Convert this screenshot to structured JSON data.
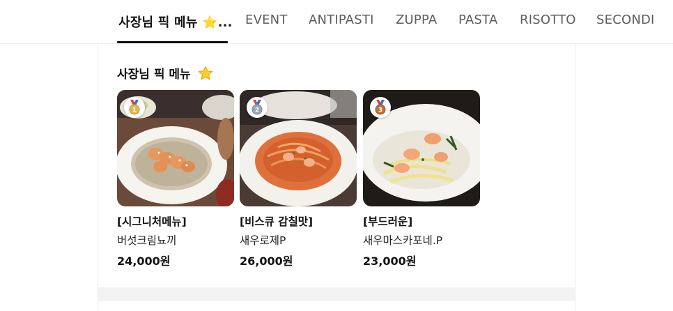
{
  "tabs": [
    {
      "label": "사장님 픽 메뉴 ⭐...",
      "active": true
    },
    {
      "label": "EVENT",
      "active": false
    },
    {
      "label": "ANTIPASTI",
      "active": false
    },
    {
      "label": "ZUPPA",
      "active": false
    },
    {
      "label": "PASTA",
      "active": false
    },
    {
      "label": "RISOTTO",
      "active": false
    },
    {
      "label": "SECONDI",
      "active": false
    }
  ],
  "section": {
    "title": "사장님 픽 메뉴",
    "title_icon": "star-icon"
  },
  "menu_items": [
    {
      "rank": "1",
      "medal": "gold-medal-icon",
      "tag": "[시그니처메뉴]",
      "name": "버섯크림뇨끼",
      "price": "24,000원",
      "medal_color": "#e8b74a"
    },
    {
      "rank": "2",
      "medal": "silver-medal-icon",
      "tag": "[비스큐 감칠맛]",
      "name": "새우로제P",
      "price": "26,000원",
      "medal_color": "#9aa7b8"
    },
    {
      "rank": "3",
      "medal": "bronze-medal-icon",
      "tag": "[부드러운]",
      "name": "새우마스카포네.P",
      "price": "23,000원",
      "medal_color": "#b8733a"
    }
  ],
  "colors": {
    "accent": "#111111",
    "tab_inactive": "#5c5c5c",
    "divider": "#efefef"
  }
}
